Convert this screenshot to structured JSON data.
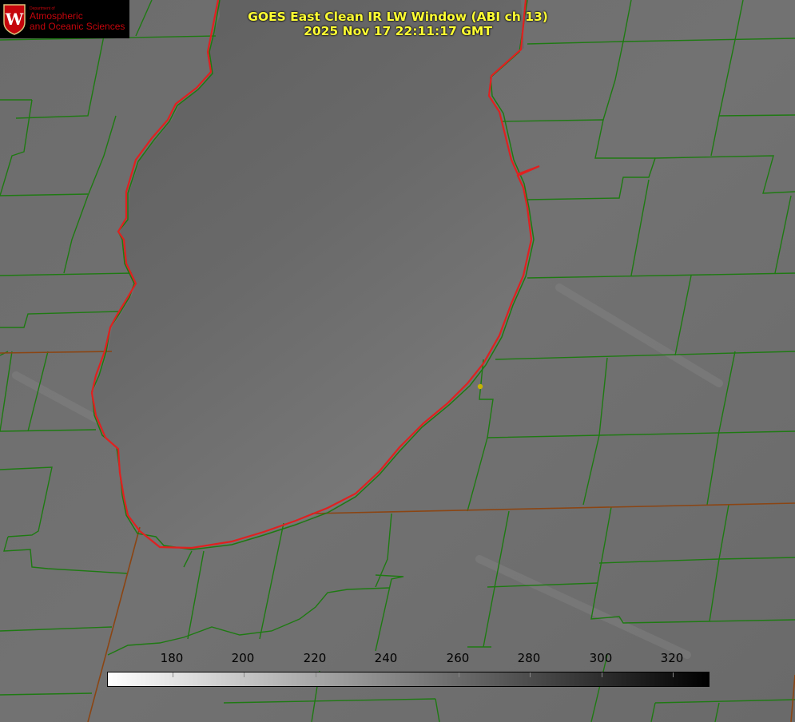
{
  "logo": {
    "department": "Department of",
    "line1": "Atmospheric",
    "line2": "and Oceanic Sciences",
    "crest_letter": "W",
    "color": "#c5050c"
  },
  "title": {
    "line1": "GOES East Clean IR LW Window (ABI ch 13)",
    "line2": "2025 Nov 17 22:11:17 GMT",
    "color": "#ffff33"
  },
  "colorbar": {
    "ticks": [
      "180",
      "200",
      "220",
      "240",
      "260",
      "280",
      "300",
      "320"
    ],
    "gradient": "white-to-black"
  },
  "colors": {
    "county_lines": "#1e7a12",
    "state_lines": "#8b4513",
    "lake_outline": "#e02020",
    "point_marker": "#c8b400"
  },
  "layers": {
    "lake": "lake-michigan-outline",
    "grid": "county-boundaries"
  }
}
